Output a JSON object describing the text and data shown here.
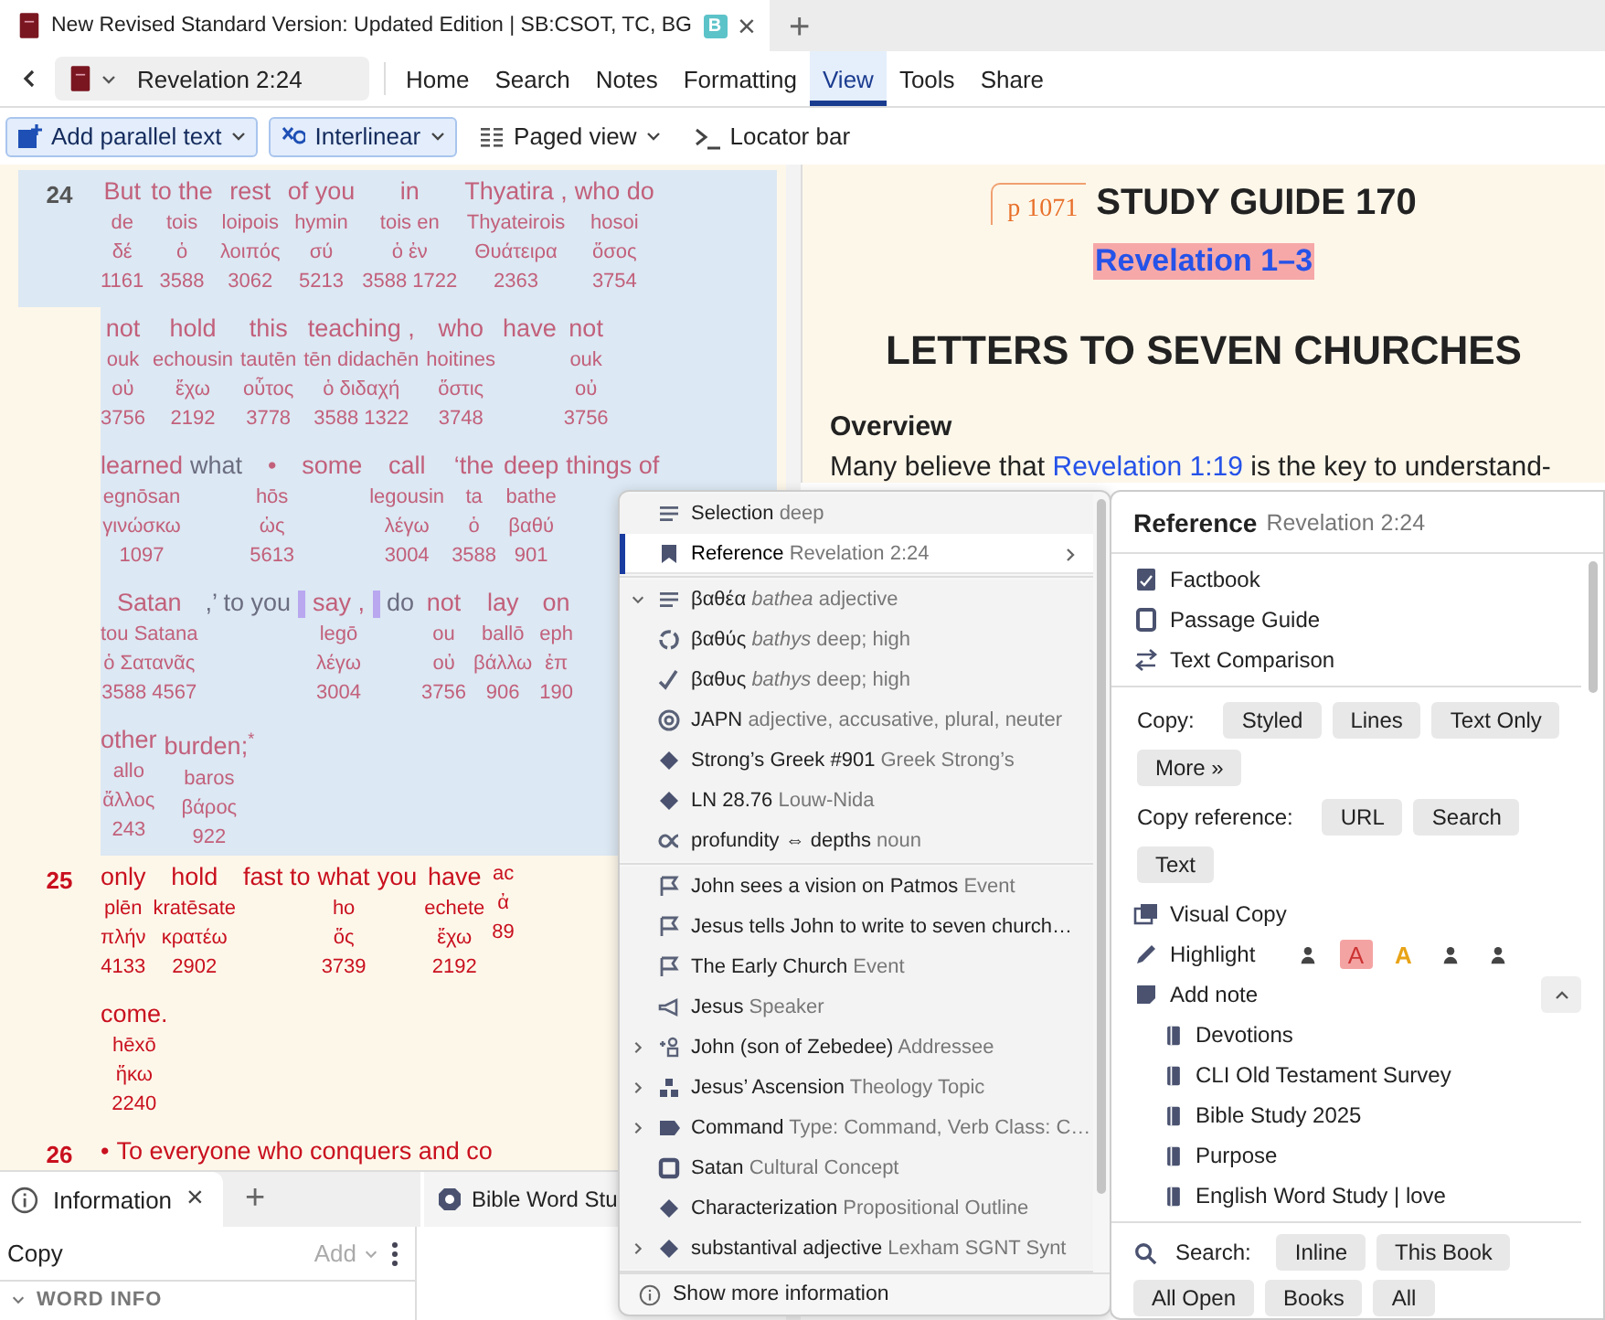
{
  "window": {
    "tab_title": "New Revised Standard Version: Updated Edition | SB:CSOT, TC, BG",
    "badge": "B",
    "close": "×",
    "new_tab": "+"
  },
  "nav": {
    "location": "Revelation 2:24",
    "menu": [
      {
        "label": "Home",
        "selected": false
      },
      {
        "label": "Search",
        "selected": false
      },
      {
        "label": "Notes",
        "selected": false
      },
      {
        "label": "Formatting",
        "selected": false
      },
      {
        "label": "View",
        "selected": true
      },
      {
        "label": "Tools",
        "selected": false
      },
      {
        "label": "Share",
        "selected": false
      }
    ]
  },
  "toolbar": [
    {
      "kind": "parallel",
      "label": "Add parallel text",
      "dropdown": true,
      "active": true
    },
    {
      "kind": "interlinear",
      "label": "Interlinear",
      "dropdown": true,
      "active": true
    },
    {
      "kind": "paged",
      "label": "Paged view",
      "dropdown": true,
      "active": false
    },
    {
      "kind": "locator",
      "label": "Locator bar",
      "dropdown": false,
      "active": false
    }
  ],
  "interlinear": {
    "verses": [
      {
        "number": "24",
        "highlighted": true,
        "lines": [
          [
            {
              "kind": "word",
              "en": "But",
              "tr": "de",
              "gk": "δέ",
              "num": "1161"
            },
            {
              "kind": "word",
              "en": "to the",
              "tr": "tois",
              "gk": "ὁ",
              "num": "3588"
            },
            {
              "kind": "word",
              "en": "rest",
              "tr": "loipois",
              "gk": "λοιπός",
              "num": "3062"
            },
            {
              "kind": "word",
              "en": "of you",
              "tr": "hymin",
              "gk": "σύ",
              "num": "5213"
            },
            {
              "kind": "word",
              "en": "in",
              "tr": "tois en",
              "gk": "ὁ ἐν",
              "num": "3588 1722"
            },
            {
              "kind": "word",
              "en": "Thyatira ,",
              "tr": "Thyateirois",
              "gk": "Θυάτειρα",
              "num": "2363"
            },
            {
              "kind": "word",
              "en": "who do",
              "tr": "hosoi",
              "gk": "ὅσος",
              "num": "3754"
            }
          ],
          [
            {
              "kind": "word",
              "en": "not",
              "tr": "ouk",
              "gk": "οὐ",
              "num": "3756"
            },
            {
              "kind": "word",
              "en": "hold",
              "tr": "echousin",
              "gk": "ἔχω",
              "num": "2192"
            },
            {
              "kind": "word",
              "en": "this",
              "tr": "tautēn",
              "gk": "οὗτος",
              "num": "3778"
            },
            {
              "kind": "word",
              "en": "teaching ,",
              "tr": "tēn didachēn",
              "gk": "ὁ διδαχή",
              "num": "3588 1322"
            },
            {
              "kind": "word",
              "en": "who",
              "tr": "hoitines",
              "gk": "ὅστις",
              "num": "3748"
            },
            {
              "kind": "word",
              "en": "have"
            },
            {
              "kind": "word",
              "en": "not",
              "tr": "ouk",
              "gk": "οὐ",
              "num": "3756"
            }
          ],
          [
            {
              "kind": "word",
              "en": "learned",
              "tr": "egnōsan",
              "gk": "γινώσκω",
              "num": "1097"
            },
            {
              "kind": "added",
              "en": "what"
            },
            {
              "kind": "word",
              "en": "•",
              "tr": "hōs",
              "gk": "ὡς",
              "num": "5613"
            },
            {
              "kind": "word",
              "en": "some"
            },
            {
              "kind": "word",
              "en": "call",
              "tr": "legousin",
              "gk": "λέγω",
              "num": "3004"
            },
            {
              "kind": "word",
              "en": "‘the",
              "tr": "ta",
              "gk": "ὁ",
              "num": "3588"
            },
            {
              "kind": "word",
              "en": "deep",
              "tr": "bathe",
              "gk": "βαθύ",
              "num": "901"
            },
            {
              "kind": "word",
              "en": "things of"
            }
          ],
          [
            {
              "kind": "word",
              "en": "Satan",
              "tr": "tou Satana",
              "gk": "ὁ Σατανᾶς",
              "num": "3588 4567"
            },
            {
              "kind": "added",
              "en": ",’ to you"
            },
            {
              "kind": "mark"
            },
            {
              "kind": "word",
              "en": "say ,",
              "tr": "legō",
              "gk": "λέγω",
              "num": "3004"
            },
            {
              "kind": "mark"
            },
            {
              "kind": "added",
              "en": "do"
            },
            {
              "kind": "word",
              "en": "not",
              "tr": "ou",
              "gk": "οὐ",
              "num": "3756"
            },
            {
              "kind": "word",
              "en": "lay",
              "tr": "ballō",
              "gk": "βάλλω",
              "num": "906"
            },
            {
              "kind": "word",
              "en": "on",
              "tr": "eph",
              "gk": "ἐπ",
              "num": "190"
            }
          ],
          [
            {
              "kind": "word",
              "en": "other",
              "tr": "allo",
              "gk": "ἄλλος",
              "num": "243"
            },
            {
              "kind": "word",
              "en": "burden;$^{*}$",
              "tr": "baros",
              "gk": "βάρος",
              "num": "922"
            }
          ]
        ]
      },
      {
        "number": "25",
        "highlighted": false,
        "lines": [
          [
            {
              "kind": "word",
              "en": "only",
              "tr": "plēn",
              "gk": "πλήν",
              "num": "4133"
            },
            {
              "kind": "word",
              "en": "hold",
              "tr": "kratēsate",
              "gk": "κρατέω",
              "num": "2902"
            },
            {
              "kind": "word",
              "en": "fast to"
            },
            {
              "kind": "word",
              "en": "what",
              "tr": "ho",
              "gk": "ὅς",
              "num": "3739"
            },
            {
              "kind": "word",
              "en": "you"
            },
            {
              "kind": "word",
              "en": "have",
              "tr": "echete",
              "gk": "ἔχω",
              "num": "2192"
            },
            {
              "kind": "word",
              "tr": "ac",
              "gk": "ἀ",
              "num": "89"
            }
          ],
          [
            {
              "kind": "word",
              "en": "come.",
              "tr": "hēxō",
              "gk": "ἥκω",
              "num": "2240"
            }
          ]
        ]
      },
      {
        "number": "26",
        "highlighted": false,
        "lines": [
          [
            {
              "kind": "word",
              "en": "•"
            },
            {
              "kind": "word",
              "en": "To everyone who conquers and co"
            }
          ]
        ]
      }
    ]
  },
  "study": {
    "page_marker": "p 1071",
    "title": "STUDY GUIDE 170",
    "subtitle": "Revelation 1–3",
    "heading": "LETTERS TO SEVEN CHURCHES",
    "section": "Overview",
    "paragraph": {
      "before": "Many believe that ",
      "link": "Revelation 1:19",
      "after": " is the key to understand-"
    }
  },
  "context_menu": {
    "sections": [
      [
        {
          "kind": "selection",
          "label": "Selection",
          "detail": "deep",
          "selected": false,
          "submenu": false,
          "expandable": false
        },
        {
          "kind": "reference",
          "label": "Reference",
          "detail": "Revelation 2:24",
          "selected": true,
          "submenu": true,
          "expandable": false
        }
      ],
      [
        {
          "kind": "word",
          "label": "βαθέα",
          "detail": "*bathea* adjective",
          "selected": false,
          "submenu": false,
          "expandable": true,
          "expanded": true
        },
        {
          "kind": "root",
          "label": "βαθύς",
          "detail": "*bathys* deep; high",
          "selected": false,
          "submenu": false,
          "expandable": false
        },
        {
          "kind": "lemma",
          "label": "βαθυς",
          "detail": "*bathys* deep; high",
          "selected": false,
          "submenu": false,
          "expandable": false
        },
        {
          "kind": "morphology",
          "label": "JAPN",
          "detail": "adjective, accusative, plural, neuter",
          "selected": false,
          "submenu": false,
          "expandable": false
        },
        {
          "kind": "dictionary",
          "label": "Strong’s Greek #901",
          "detail": "Greek Strong’s",
          "selected": false,
          "submenu": false,
          "expandable": false
        },
        {
          "kind": "dictionary",
          "label": "LN 28.76",
          "detail": "Louw-Nida",
          "selected": false,
          "submenu": false,
          "expandable": false
        },
        {
          "kind": "sense",
          "label": "profundity ⇔ depths",
          "detail": "noun",
          "selected": false,
          "submenu": false,
          "expandable": false
        }
      ],
      [
        {
          "kind": "event",
          "label": "John sees a vision on Patmos",
          "detail": "Event",
          "selected": false,
          "submenu": false,
          "expandable": false
        },
        {
          "kind": "event",
          "label": "Jesus tells John to write to seven church…",
          "selected": false,
          "submenu": false,
          "expandable": false
        },
        {
          "kind": "event",
          "label": "The Early Church",
          "detail": "Event",
          "selected": false,
          "submenu": false,
          "expandable": false
        },
        {
          "kind": "speaker",
          "label": "Jesus",
          "detail": "Speaker",
          "selected": false,
          "submenu": false,
          "expandable": false
        },
        {
          "kind": "addressee",
          "label": "John (son of Zebedee)",
          "detail": "Addressee",
          "selected": false,
          "submenu": false,
          "expandable": true,
          "expanded": false
        },
        {
          "kind": "topic",
          "label": "Jesus’ Ascension",
          "detail": "Theology Topic",
          "selected": false,
          "submenu": false,
          "expandable": true,
          "expanded": false
        },
        {
          "kind": "clause",
          "label": "Command",
          "detail": "Type: Command, Verb Class: C…",
          "selected": false,
          "submenu": false,
          "expandable": true,
          "expanded": false
        },
        {
          "kind": "concept",
          "label": "Satan",
          "detail": "Cultural Concept",
          "selected": false,
          "submenu": false,
          "expandable": false
        },
        {
          "kind": "dictionary",
          "label": "Characterization",
          "detail": "Propositional Outline",
          "selected": false,
          "submenu": false,
          "expandable": false
        },
        {
          "kind": "dictionary",
          "label": "substantival adjective",
          "detail": "Lexham SGNT Synt",
          "selected": false,
          "submenu": false,
          "expandable": true,
          "expanded": false
        }
      ]
    ],
    "footer": "Show more information"
  },
  "reference_panel": {
    "title": "Reference",
    "reference": "Revelation 2:24",
    "links": [
      {
        "kind": "factbook",
        "label": "Factbook"
      },
      {
        "kind": "guide",
        "label": "Passage Guide"
      },
      {
        "kind": "compare",
        "label": "Text Comparison"
      }
    ],
    "copy": {
      "label": "Copy:",
      "buttons": [
        "Styled",
        "Lines",
        "Text Only",
        "More »"
      ]
    },
    "copy_reference": {
      "label": "Copy reference:",
      "buttons": [
        "URL",
        "Search",
        "Text"
      ]
    },
    "visual_copy": "Visual Copy",
    "highlight": {
      "label": "Highlight",
      "styles": [
        {
          "kind": "person"
        },
        {
          "kind": "letter",
          "text": "A",
          "color": "#f4a3a3"
        },
        {
          "kind": "letter",
          "text": "A",
          "color": "#e8a317"
        },
        {
          "kind": "person"
        },
        {
          "kind": "person"
        }
      ]
    },
    "add_note": {
      "label": "Add note",
      "expanded": true,
      "notebooks": [
        "Devotions",
        "CLI Old Testament Survey",
        "Bible Study 2025",
        "Purpose",
        "English Word Study | love"
      ]
    },
    "search": {
      "label": "Search:",
      "buttons": [
        "Inline",
        "This Book",
        "All Open",
        "Books",
        "All"
      ]
    }
  },
  "info_panel": {
    "tabs": [
      {
        "label": "Information",
        "selected": true,
        "close": "×"
      }
    ],
    "new_tab": "+",
    "other_tab": "Bible Word Stu",
    "copy": "Copy",
    "add": "Add",
    "add_disabled": true,
    "section": "WORD INFO",
    "section_expanded": true
  }
}
